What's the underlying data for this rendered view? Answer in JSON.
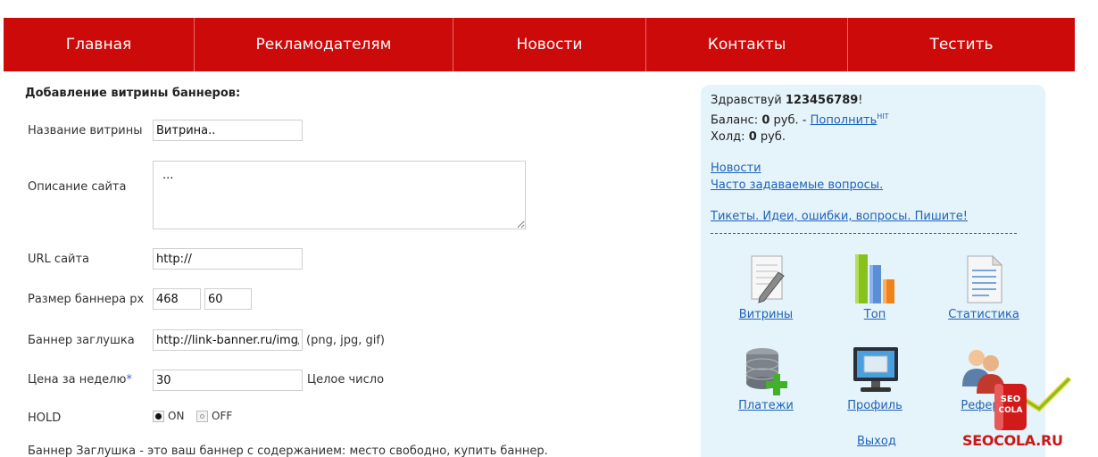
{
  "nav": {
    "items": [
      "Главная",
      "Рекламодателям",
      "Новости",
      "Контакты",
      "Тестить"
    ]
  },
  "form": {
    "title": "Добавление витрины баннеров:",
    "name_label": "Название витрины",
    "name_value": "Витрина..",
    "desc_label": "Описание сайта",
    "desc_value": "...",
    "url_label": "URL сайта",
    "url_value": "http://",
    "size_label": "Размер баннера px",
    "size_width": "468",
    "size_height": "60",
    "stub_label": "Баннер заглушка",
    "stub_value": "http://link-banner.ru/img/",
    "stub_hint": "(png, jpg, gif)",
    "price_label": "Цена за неделю",
    "price_star": "*",
    "price_value": "30",
    "price_hint": "Целое число",
    "hold_label": "HOLD",
    "hold_on": "ON",
    "hold_off": "OFF",
    "hold_selected": "ON",
    "footer_note": "Баннер Заглушка - это ваш баннер с содержанием: место свободно, купить баннер."
  },
  "sidebar": {
    "greeting": "Здравствуй",
    "username": "123456789",
    "greeting_end": "!",
    "balance_label": "Баланс:",
    "balance_value": "0",
    "currency": "руб.",
    "balance_sep": "-",
    "topup_link": "Пополнить",
    "topup_sup": "HIT",
    "hold_label": "Холд:",
    "hold_value": "0",
    "links": {
      "news": "Новости",
      "faq": "Часто задаваемые вопросы.",
      "tickets": "Тикеты. Идеи, ошибки, вопросы. Пишите!"
    },
    "tiles": [
      {
        "label": "Витрины",
        "icon": "document-pen-icon"
      },
      {
        "label": "Топ",
        "icon": "bar-chart-icon"
      },
      {
        "label": "Статистика",
        "icon": "document-lines-icon"
      },
      {
        "label": "Платежи",
        "icon": "database-add-icon"
      },
      {
        "label": "Профиль",
        "icon": "monitor-icon"
      },
      {
        "label": "Рефера",
        "icon": "users-icon"
      }
    ],
    "logout": "Выход"
  },
  "watermark": {
    "text": "SEOCOLA.RU",
    "can_text": "SEO COLA"
  }
}
